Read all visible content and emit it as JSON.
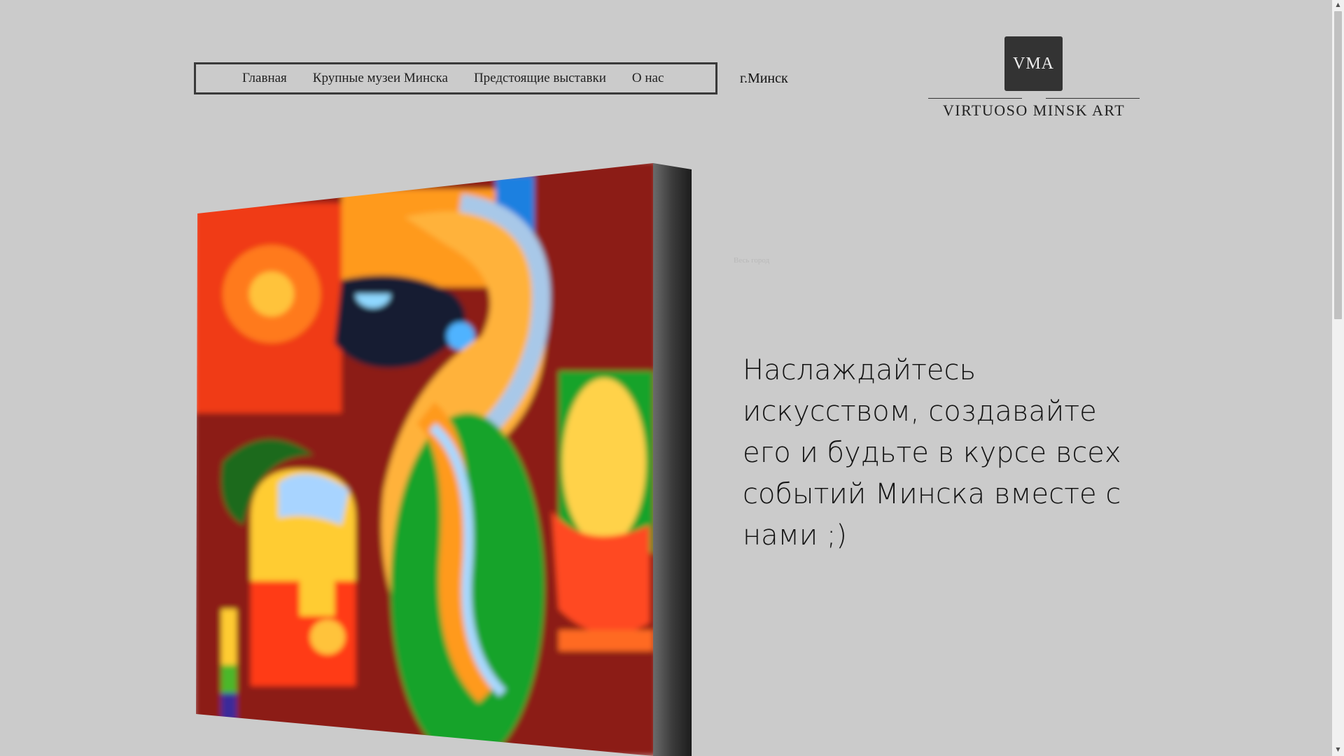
{
  "nav": {
    "items": [
      "Главная",
      "Крупные музеи Минска",
      "Предстоящие выставки",
      "О нас"
    ]
  },
  "city": "г.Минск",
  "logo": {
    "abbr": "VMA",
    "name": "VIRTUOSO MINSK ART"
  },
  "hero": {
    "text": "Наслаждайтесь искусством, создавайте его и будьте в курсе всех событий Минска вместе с нами ;)",
    "faint_link": "Весь город"
  },
  "colors": {
    "background": "#cbcbcb",
    "nav_border": "#3a3a3a",
    "logo_box": "#333333"
  },
  "icons": {
    "scroll_up": "triangle-up",
    "scroll_down": "triangle-down"
  }
}
